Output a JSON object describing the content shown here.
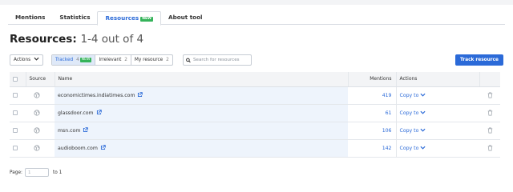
{
  "tabs": [
    {
      "label": "Mentions"
    },
    {
      "label": "Statistics"
    },
    {
      "label": "Resources",
      "badge": "NEW",
      "active": true
    },
    {
      "label": "About tool"
    }
  ],
  "page": {
    "title": "Resources:",
    "range": "1-4 out of 4"
  },
  "toolbar": {
    "actions_label": "Actions",
    "filters": [
      {
        "label": "Tracked",
        "count": "4",
        "badge": "NEW",
        "active": true
      },
      {
        "label": "Irrelevant",
        "count": "2"
      },
      {
        "label": "My resource",
        "count": "2"
      }
    ],
    "search_placeholder": "Search for resources",
    "track_button": "Track resource"
  },
  "table": {
    "columns": {
      "source": "Source",
      "name": "Name",
      "mentions": "Mentions",
      "actions": "Actions"
    },
    "rows": [
      {
        "name": "economictimes.indiatimes.com",
        "mentions": "419",
        "action": "Copy to"
      },
      {
        "name": "glassdoor.com",
        "mentions": "61",
        "action": "Copy to"
      },
      {
        "name": "msn.com",
        "mentions": "106",
        "action": "Copy to"
      },
      {
        "name": "audioboom.com",
        "mentions": "142",
        "action": "Copy to"
      }
    ]
  },
  "pagination": {
    "label": "Page:",
    "placeholder": "1",
    "to_label": "to 1"
  },
  "colors": {
    "accent": "#2b6ad8",
    "badge_green": "#35b35a",
    "row_highlight": "#eef4fc"
  },
  "icons": [
    "globe-icon",
    "external-link-icon",
    "chevron-down-icon",
    "trash-icon",
    "search-icon"
  ]
}
